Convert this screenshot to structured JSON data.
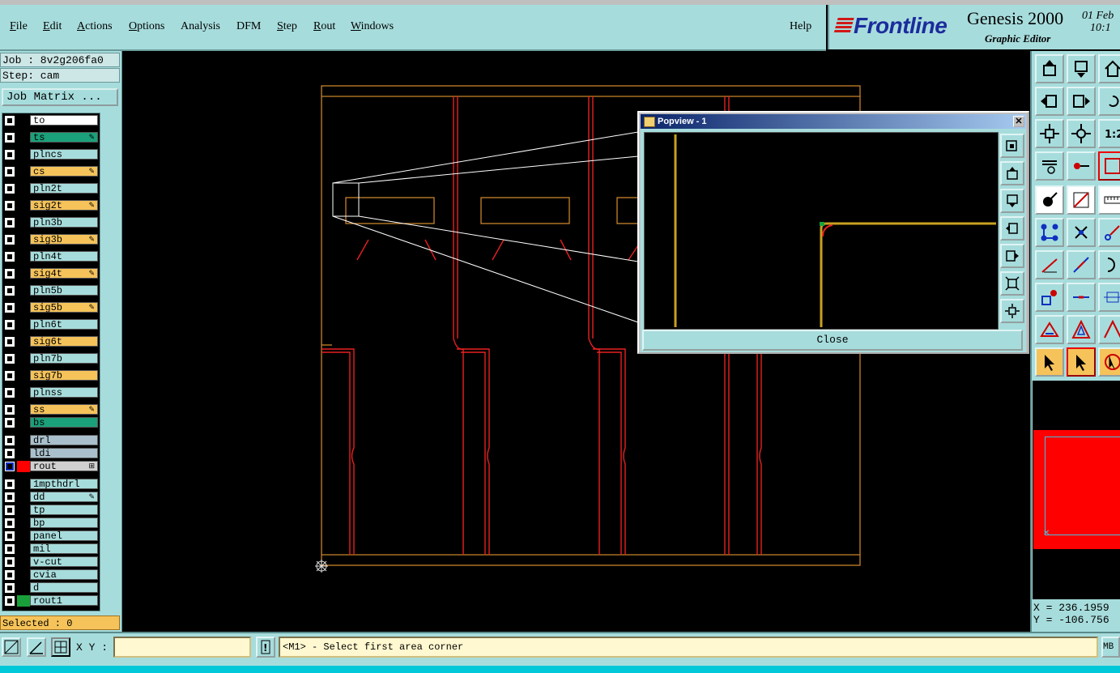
{
  "menu": {
    "items": [
      {
        "label": "File",
        "ul": "F"
      },
      {
        "label": "Edit",
        "ul": "E"
      },
      {
        "label": "Actions",
        "ul": "A"
      },
      {
        "label": "Options",
        "ul": "O"
      },
      {
        "label": "Analysis",
        "ul": ""
      },
      {
        "label": "DFM",
        "ul": ""
      },
      {
        "label": "Step",
        "ul": "S"
      },
      {
        "label": "Rout",
        "ul": "R"
      },
      {
        "label": "Windows",
        "ul": "W"
      }
    ],
    "help": "Help"
  },
  "brand": {
    "logo": "Frontline",
    "product": "Genesis 2000",
    "subtitle": "Graphic Editor",
    "date_line1": "01 Feb",
    "date_line2": "10:1"
  },
  "left": {
    "job": "Job : 8v2g206fa0",
    "step": "Step: cam",
    "job_matrix": "Job Matrix ...",
    "selected": "Selected : 0"
  },
  "layers": [
    {
      "name": "to",
      "bg": "#ffffff",
      "color": "",
      "mark": ""
    },
    {
      "name": "ts",
      "bg": "#1aa07a",
      "color": "",
      "mark": "✎"
    },
    {
      "name": "plncs",
      "bg": "#a7dcdc",
      "color": "",
      "mark": ""
    },
    {
      "name": "cs",
      "bg": "#f5c35a",
      "color": "",
      "mark": "✎"
    },
    {
      "name": "pln2t",
      "bg": "#a7dcdc",
      "color": "",
      "mark": ""
    },
    {
      "name": "sig2t",
      "bg": "#f5c35a",
      "color": "",
      "mark": "✎"
    },
    {
      "name": "pln3b",
      "bg": "#a7dcdc",
      "color": "",
      "mark": ""
    },
    {
      "name": "sig3b",
      "bg": "#f5c35a",
      "color": "",
      "mark": "✎"
    },
    {
      "name": "pln4t",
      "bg": "#a7dcdc",
      "color": "",
      "mark": ""
    },
    {
      "name": "sig4t",
      "bg": "#f5c35a",
      "color": "",
      "mark": "✎"
    },
    {
      "name": "pln5b",
      "bg": "#a7dcdc",
      "color": "",
      "mark": ""
    },
    {
      "name": "sig5b",
      "bg": "#f5c35a",
      "color": "",
      "mark": "✎"
    },
    {
      "name": "pln6t",
      "bg": "#a7dcdc",
      "color": "",
      "mark": ""
    },
    {
      "name": "sig6t",
      "bg": "#f5c35a",
      "color": "",
      "mark": ""
    },
    {
      "name": "pln7b",
      "bg": "#a7dcdc",
      "color": "",
      "mark": ""
    },
    {
      "name": "sig7b",
      "bg": "#f5c35a",
      "color": "",
      "mark": ""
    },
    {
      "name": "plnss",
      "bg": "#a7dcdc",
      "color": "",
      "mark": ""
    },
    {
      "name": "ss",
      "bg": "#f5c35a",
      "color": "",
      "mark": "✎"
    },
    {
      "name": "bs",
      "bg": "#1aa07a",
      "color": "",
      "mark": ""
    },
    {
      "name": "drl",
      "bg": "#a9c0cc",
      "color": "",
      "mark": ""
    },
    {
      "name": "ldi",
      "bg": "#a9c0cc",
      "color": "",
      "mark": ""
    },
    {
      "name": "rout",
      "bg": "#d0d0d0",
      "color": "#ff0000",
      "mark": "⊞"
    },
    {
      "name": "1mpthdrl",
      "bg": "#a7dcdc",
      "color": "",
      "mark": ""
    },
    {
      "name": "dd",
      "bg": "#a7dcdc",
      "color": "",
      "mark": "✎"
    },
    {
      "name": "tp",
      "bg": "#a7dcdc",
      "color": "",
      "mark": ""
    },
    {
      "name": "bp",
      "bg": "#a7dcdc",
      "color": "",
      "mark": ""
    },
    {
      "name": "panel",
      "bg": "#a7dcdc",
      "color": "",
      "mark": ""
    },
    {
      "name": "mil",
      "bg": "#a7dcdc",
      "color": "",
      "mark": ""
    },
    {
      "name": "v-cut",
      "bg": "#a7dcdc",
      "color": "",
      "mark": ""
    },
    {
      "name": "cvia",
      "bg": "#a7dcdc",
      "color": "",
      "mark": ""
    },
    {
      "name": "d",
      "bg": "#a7dcdc",
      "color": "",
      "mark": ""
    },
    {
      "name": "rout1",
      "bg": "#a7dcdc",
      "color": "#1aa03a",
      "mark": ""
    }
  ],
  "popview": {
    "title": "Popview - 1",
    "close": "Close"
  },
  "right": {
    "x": "X = 236.1959",
    "y": "Y = -106.756"
  },
  "status": {
    "xy_label": "X Y :",
    "xy_value": "",
    "message": "<M1> - Select first area corner",
    "mb": "MB"
  },
  "colors": {
    "panel": "#a7dcdc",
    "outline": "#c8832a",
    "rout": "#e82020",
    "pop_trace": "#c8a020"
  }
}
